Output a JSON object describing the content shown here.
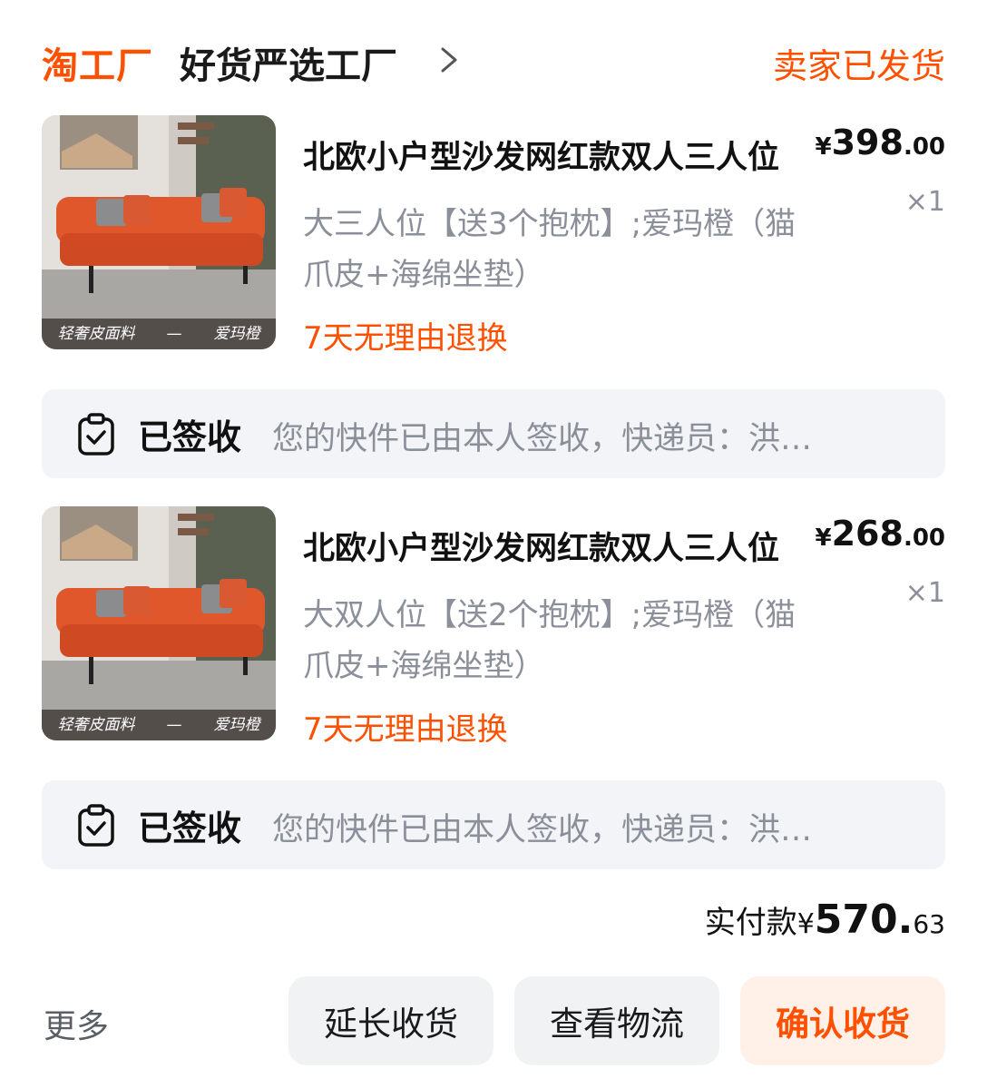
{
  "header": {
    "brand": "淘工厂",
    "shop_name": "好货严选工厂",
    "order_status": "卖家已发货"
  },
  "items": [
    {
      "title": "北欧小户型沙发网红款双人三人位",
      "price_currency": "¥",
      "price_int": "398",
      "price_dec": ".00",
      "quantity": "×1",
      "spec": "大三人位【送3个抱枕】;爱玛橙（猫爪皮+海绵坐垫）",
      "promise": "7天无理由退换",
      "thumb_caption_left": "轻奢皮面料",
      "thumb_caption_mid": "—",
      "thumb_caption_right": "爱玛橙"
    },
    {
      "title": "北欧小户型沙发网红款双人三人位",
      "price_currency": "¥",
      "price_int": "268",
      "price_dec": ".00",
      "quantity": "×1",
      "spec": "大双人位【送2个抱枕】;爱玛橙（猫爪皮+海绵坐垫）",
      "promise": "7天无理由退换",
      "thumb_caption_left": "轻奢皮面料",
      "thumb_caption_mid": "—",
      "thumb_caption_right": "爱玛橙"
    }
  ],
  "signed": [
    {
      "label": "已签收",
      "text": "您的快件已由本人签收，快递员：洪…"
    },
    {
      "label": "已签收",
      "text": "您的快件已由本人签收，快递员：洪…"
    }
  ],
  "total": {
    "label": "实付款",
    "currency": "¥",
    "amount_int": "570.",
    "amount_dec": "63"
  },
  "actions": {
    "more": "更多",
    "extend": "延长收货",
    "logistics": "查看物流",
    "confirm": "确认收货"
  },
  "colors": {
    "accent": "#ff5000",
    "muted_text": "#8a8f99",
    "panel_bg": "#f2f4f7"
  }
}
